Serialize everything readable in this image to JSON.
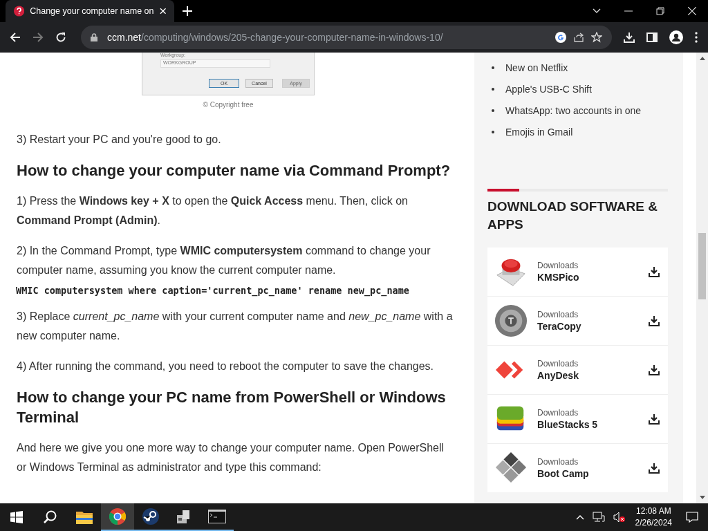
{
  "browser": {
    "tab_title": "Change your computer name on",
    "url_domain": "ccm.net",
    "url_path": "/computing/windows/205-change-your-computer-name-in-windows-10/"
  },
  "figure": {
    "workgroup_label": "Workgroup:",
    "workgroup_value": "WORKGROUP",
    "buttons": [
      {
        "label": "OK",
        "disabled": false
      },
      {
        "label": "Cancel",
        "disabled": false
      },
      {
        "label": "Apply",
        "disabled": true
      }
    ],
    "caption": "© Copyright free"
  },
  "article": [
    {
      "kind": "paragraph",
      "text": "3) Restart your PC and you're good to go."
    },
    {
      "kind": "heading",
      "text": "How to change your computer name via Command Prompt?"
    },
    {
      "kind": "paragraph",
      "text": "1) Press the **Windows key + X** to open the **Quick Access** menu. Then, click on **Command Prompt (Admin)**."
    },
    {
      "kind": "paragraph",
      "text": "2) In the Command Prompt, type  **WMIC computersystem** command to change your computer name, assuming you know the current computer name."
    },
    {
      "kind": "code",
      "text": "WMIC computersystem where caption='current_pc_name' rename new_pc_name"
    },
    {
      "kind": "paragraph",
      "text": "3) Replace *current_pc_name* with your current computer name and *new_pc_name* with a new computer name."
    },
    {
      "kind": "paragraph",
      "text": "4) After running the command, you need to reboot the computer to save the changes."
    },
    {
      "kind": "heading",
      "text": "How to change your PC name from PowerShell or Windows Terminal"
    },
    {
      "kind": "paragraph",
      "text": "And here we give you one more way to change your computer name. Open PowerShell or Windows Terminal as administrator and type this command:"
    }
  ],
  "sidebar": {
    "links": [
      "New on Netflix",
      "Apple's USB-C Shift",
      "WhatsApp: two accounts in one",
      "Emojis in Gmail"
    ],
    "section_title": "DOWNLOAD SOFTWARE & APPS",
    "downloads": [
      {
        "category": "Downloads",
        "name": "KMSPico",
        "kind": "button"
      },
      {
        "category": "Downloads",
        "name": "TeraCopy",
        "kind": "disc"
      },
      {
        "category": "Downloads",
        "name": "AnyDesk",
        "kind": "arrows"
      },
      {
        "category": "Downloads",
        "name": "BlueStacks 5",
        "kind": "stack"
      },
      {
        "category": "Downloads",
        "name": "Boot Camp",
        "kind": "diamonds"
      }
    ]
  },
  "taskbar": {
    "apps": [
      {
        "kind": "folder",
        "selected": false,
        "running": false
      },
      {
        "kind": "chrome",
        "selected": true,
        "running": true
      },
      {
        "kind": "steam",
        "selected": false,
        "running": true
      },
      {
        "kind": "installer",
        "selected": false,
        "running": true
      },
      {
        "kind": "terminal",
        "selected": false,
        "running": true
      }
    ],
    "time": "12:08 AM",
    "date": "2/26/2024"
  }
}
